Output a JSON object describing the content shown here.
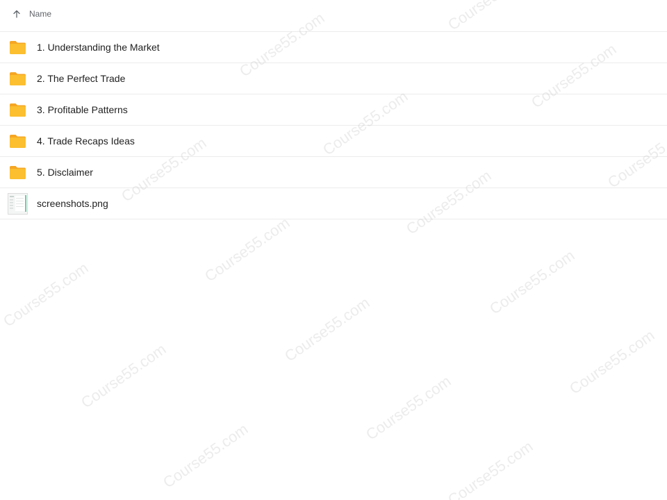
{
  "header": {
    "sort_icon": "arrow-up-icon",
    "column_label": "Name"
  },
  "items": [
    {
      "type": "folder",
      "icon": "folder-icon",
      "name": "1. Understanding the Market"
    },
    {
      "type": "folder",
      "icon": "folder-icon",
      "name": "2. The Perfect Trade"
    },
    {
      "type": "folder",
      "icon": "folder-icon",
      "name": "3. Profitable Patterns"
    },
    {
      "type": "folder",
      "icon": "folder-icon",
      "name": "4. Trade Recaps Ideas"
    },
    {
      "type": "folder",
      "icon": "folder-icon",
      "name": "5. Disclaimer"
    },
    {
      "type": "image",
      "icon": "image-thumbnail-icon",
      "name": "screenshots.png"
    }
  ],
  "watermark": "Course55.com",
  "colors": {
    "folder": "#f9b72a",
    "folder_tab": "#f5a623",
    "divider": "#ececec",
    "text": "#1f1f1f",
    "header_text": "#5f6368"
  }
}
